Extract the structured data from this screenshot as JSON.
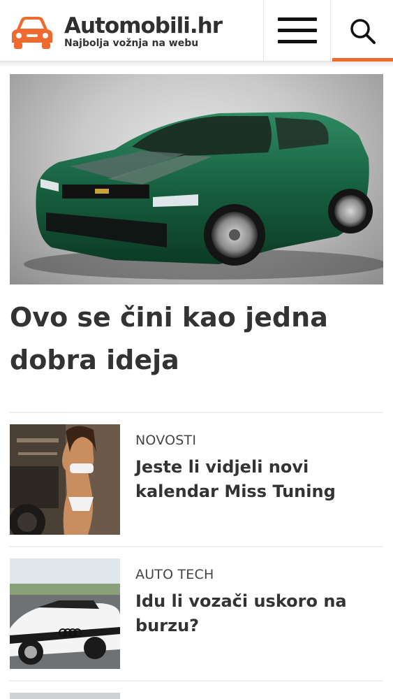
{
  "header": {
    "site_name": "Automobili.hr",
    "tagline": "Najbolja vožnja na webu",
    "logo_icon": "car-icon",
    "menu_icon": "hamburger-menu-icon",
    "search_icon": "search-icon",
    "accent_color": "#ef6a2e"
  },
  "hero": {
    "title": " Ovo se čini kao jedna dobra ideja",
    "image_icon": "green-sports-car-image"
  },
  "news": [
    {
      "category": "NOVOSTI",
      "title": "Jeste li vidjeli novi kalendar Miss Tuning"
    },
    {
      "category": "AUTO TECH",
      "title": "Idu li vozači uskoro na burzu?"
    }
  ]
}
